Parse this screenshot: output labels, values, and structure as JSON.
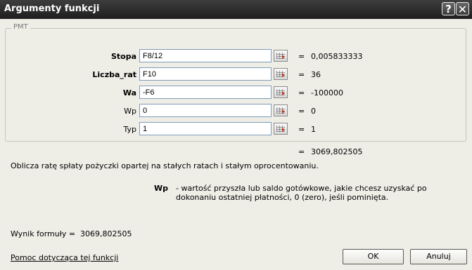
{
  "dialog": {
    "title": "Argumenty funkcji",
    "help_button": "?",
    "close_button": "✕"
  },
  "function_group": {
    "name": "PMT",
    "args": [
      {
        "label": "Stopa",
        "bold": true,
        "value": "F8/12",
        "result": "0,005833333"
      },
      {
        "label": "Liczba_rat",
        "bold": true,
        "value": "F10",
        "result": "36"
      },
      {
        "label": "Wa",
        "bold": true,
        "value": "-F6",
        "result": "-100000"
      },
      {
        "label": "Wp",
        "bold": false,
        "value": "0",
        "result": "0"
      },
      {
        "label": "Typ",
        "bold": false,
        "value": "1",
        "result": "1"
      }
    ],
    "equals": "="
  },
  "total_result": "3069,802505",
  "description": "Oblicza ratę spłaty pożyczki opartej na stałych ratach i stałym oprocentowaniu.",
  "param_help": {
    "name": "Wp",
    "text": "- wartość przyszła lub saldo gotówkowe, jakie chcesz uzyskać po dokonaniu ostatniej płatności, 0 (zero), jeśli pominięta."
  },
  "formula_result": {
    "label": "Wynik formuły =",
    "value": "3069,802505"
  },
  "help_link": "Pomoc dotycząca tej funkcji",
  "buttons": {
    "ok": "OK",
    "cancel": "Anuluj"
  }
}
